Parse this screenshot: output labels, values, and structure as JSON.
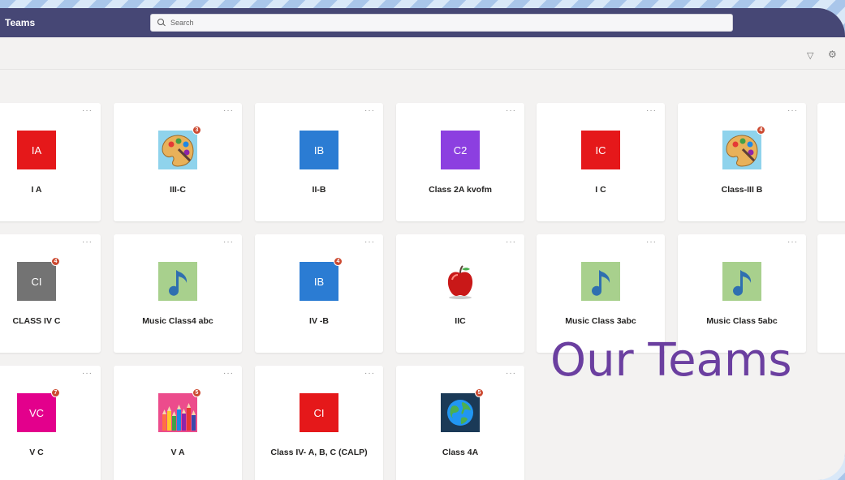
{
  "app": {
    "title": "Teams"
  },
  "search": {
    "placeholder": "Search"
  },
  "toolbar": {
    "filter_icon": "filter-icon",
    "settings_icon": "settings-icon"
  },
  "more_label": "···",
  "colors": {
    "topbar": "#464775",
    "red": "#e5181a",
    "blue": "#2b7cd3",
    "purple": "#8c3fe0",
    "gray": "#737373",
    "magenta": "#e3008c",
    "promo_text": "#6b3fa0"
  },
  "teams": [
    {
      "name": "I A",
      "tile": "IA",
      "tile_color": "#e5181a",
      "icon": null,
      "badge": null
    },
    {
      "name": "III-C",
      "tile": "",
      "tile_color": "",
      "icon": "palette-icon",
      "badge": "3"
    },
    {
      "name": "II-B",
      "tile": "IB",
      "tile_color": "#2b7cd3",
      "icon": null,
      "badge": null
    },
    {
      "name": "Class 2A kvofm",
      "tile": "C2",
      "tile_color": "#8c3fe0",
      "icon": null,
      "badge": null
    },
    {
      "name": "I C",
      "tile": "IC",
      "tile_color": "#e5181a",
      "icon": null,
      "badge": null
    },
    {
      "name": "Class-III B",
      "tile": "",
      "tile_color": "",
      "icon": "palette-icon",
      "badge": "4"
    },
    {
      "name": "CLASS IV C",
      "tile": "CI",
      "tile_color": "#737373",
      "icon": null,
      "badge": "4"
    },
    {
      "name": "Music Class4 abc",
      "tile": "",
      "tile_color": "",
      "icon": "music-note-icon",
      "badge": null
    },
    {
      "name": "IV -B",
      "tile": "IB",
      "tile_color": "#2b7cd3",
      "icon": null,
      "badge": "4"
    },
    {
      "name": "IIC",
      "tile": "",
      "tile_color": "",
      "icon": "apple-icon",
      "badge": null
    },
    {
      "name": "Music Class 3abc",
      "tile": "",
      "tile_color": "",
      "icon": "music-note-icon",
      "badge": null
    },
    {
      "name": "Music Class 5abc",
      "tile": "",
      "tile_color": "",
      "icon": "music-note-icon",
      "badge": null
    },
    {
      "name": "V C",
      "tile": "VC",
      "tile_color": "#e3008c",
      "icon": null,
      "badge": "7"
    },
    {
      "name": "V A",
      "tile": "",
      "tile_color": "",
      "icon": "pencils-icon",
      "badge": "5"
    },
    {
      "name": "Class IV- A, B, C (CALP)",
      "tile": "CI",
      "tile_color": "#e5181a",
      "icon": null,
      "badge": null
    },
    {
      "name": "Class 4A",
      "tile": "",
      "tile_color": "",
      "icon": "globe-icon",
      "badge": "5"
    }
  ],
  "promo": {
    "text": "Our Teams"
  }
}
